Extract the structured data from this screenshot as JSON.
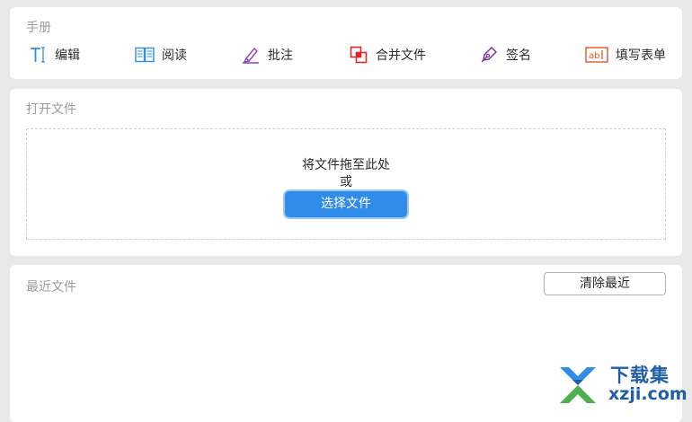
{
  "manual": {
    "title": "手册",
    "tools": [
      {
        "label": "编辑",
        "icon": "text-cursor-icon",
        "color": "#2f8ce8"
      },
      {
        "label": "阅读",
        "icon": "book-icon",
        "color": "#2f8ce8"
      },
      {
        "label": "批注",
        "icon": "highlighter-icon",
        "color": "#8a3fc9"
      },
      {
        "label": "合并文件",
        "icon": "merge-files-icon",
        "color": "#e0262b"
      },
      {
        "label": "签名",
        "icon": "pen-nib-icon",
        "color": "#7a2a9c"
      },
      {
        "label": "填写表单",
        "icon": "form-field-icon",
        "color": "#e8552b"
      }
    ]
  },
  "open_file": {
    "title": "打开文件",
    "drop_text": "将文件拖至此处",
    "or_text": "或",
    "choose_button": "选择文件"
  },
  "recent": {
    "title": "最近文件",
    "clear_button": "清除最近"
  },
  "watermark": {
    "cn_text": "下载集",
    "url_text": "xzji.com"
  },
  "colors": {
    "accent": "#2f8ce8",
    "background": "#e9e9e9",
    "card": "#ffffff",
    "muted_text": "#9b9b9b"
  }
}
